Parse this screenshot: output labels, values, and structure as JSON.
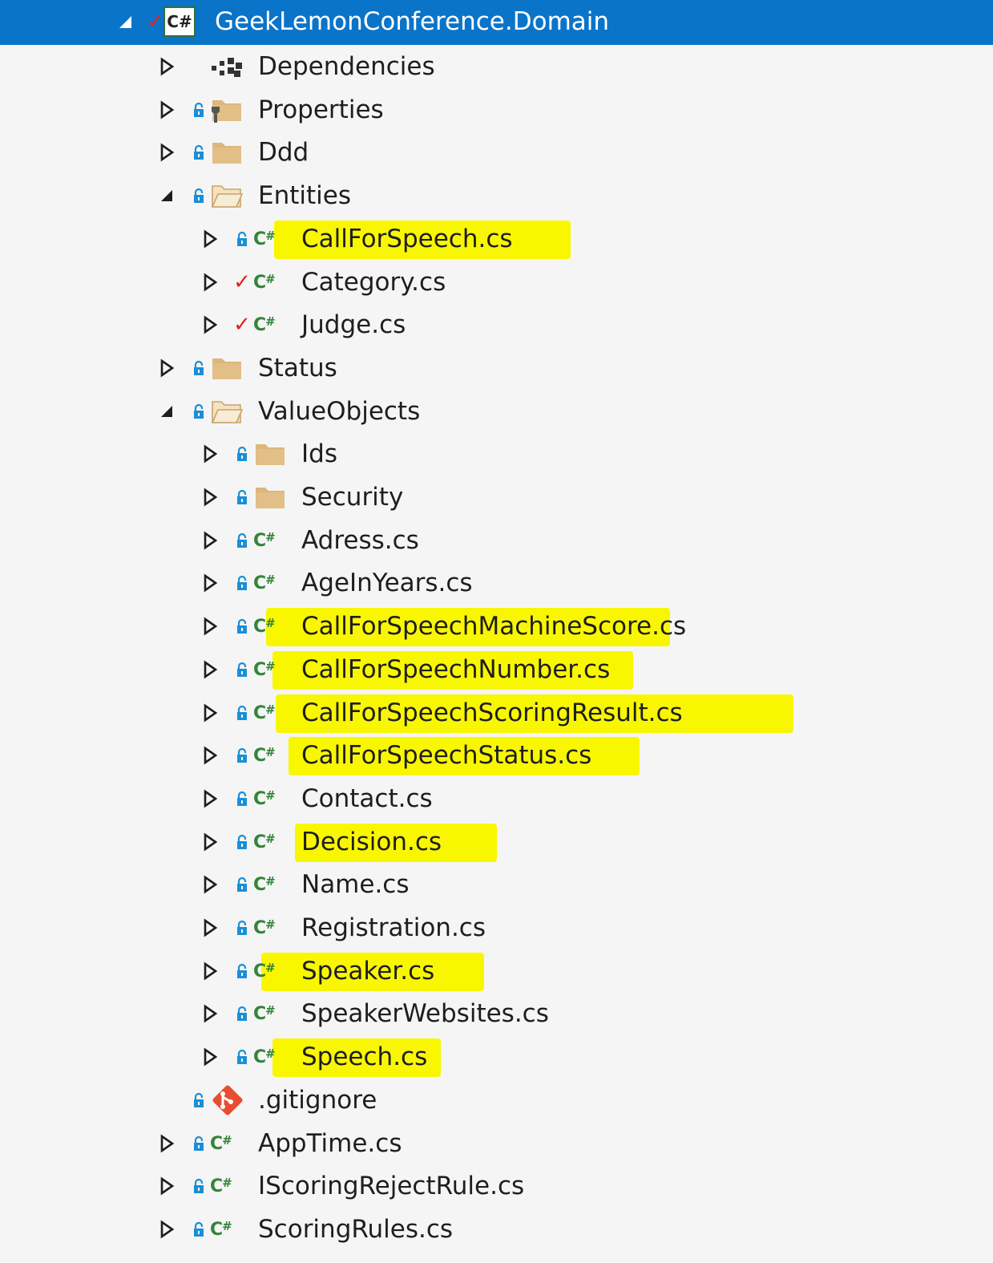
{
  "project": {
    "name": "GeekLemonConference.Domain",
    "icon": "csharp-project-icon"
  },
  "highlight_color": "#f9f700",
  "selection_color": "#0a74c9",
  "items": [
    {
      "key": "dependencies",
      "label": "Dependencies",
      "depth": 1,
      "expander": "collapsed",
      "status": "none",
      "icon": "dependencies-icon"
    },
    {
      "key": "properties",
      "label": "Properties",
      "depth": 1,
      "expander": "collapsed",
      "status": "lock",
      "icon": "properties-folder-icon"
    },
    {
      "key": "ddd",
      "label": "Ddd",
      "depth": 1,
      "expander": "collapsed",
      "status": "lock",
      "icon": "folder-icon"
    },
    {
      "key": "entities",
      "label": "Entities",
      "depth": 1,
      "expander": "expanded",
      "status": "lock",
      "icon": "folder-open-icon"
    },
    {
      "key": "callforspeech",
      "label": "CallForSpeech.cs",
      "depth": 2,
      "expander": "collapsed",
      "status": "lock",
      "icon": "csharp-file-icon",
      "highlighted": true
    },
    {
      "key": "category",
      "label": "Category.cs",
      "depth": 2,
      "expander": "collapsed",
      "status": "check",
      "icon": "csharp-file-icon"
    },
    {
      "key": "judge",
      "label": "Judge.cs",
      "depth": 2,
      "expander": "collapsed",
      "status": "check",
      "icon": "csharp-file-icon"
    },
    {
      "key": "status",
      "label": "Status",
      "depth": 1,
      "expander": "collapsed",
      "status": "lock",
      "icon": "folder-icon"
    },
    {
      "key": "valueobjects",
      "label": "ValueObjects",
      "depth": 1,
      "expander": "expanded",
      "status": "lock",
      "icon": "folder-open-icon"
    },
    {
      "key": "ids",
      "label": "Ids",
      "depth": 2,
      "expander": "collapsed",
      "status": "lock",
      "icon": "folder-icon"
    },
    {
      "key": "security",
      "label": "Security",
      "depth": 2,
      "expander": "collapsed",
      "status": "lock",
      "icon": "folder-icon"
    },
    {
      "key": "adress",
      "label": "Adress.cs",
      "depth": 2,
      "expander": "collapsed",
      "status": "lock",
      "icon": "csharp-file-icon"
    },
    {
      "key": "ageinyears",
      "label": "AgeInYears.cs",
      "depth": 2,
      "expander": "collapsed",
      "status": "lock",
      "icon": "csharp-file-icon"
    },
    {
      "key": "cfsmachinescore",
      "label": "CallForSpeechMachineScore.cs",
      "depth": 2,
      "expander": "collapsed",
      "status": "lock",
      "icon": "csharp-file-icon",
      "highlighted": true
    },
    {
      "key": "cfsnumber",
      "label": "CallForSpeechNumber.cs",
      "depth": 2,
      "expander": "collapsed",
      "status": "lock",
      "icon": "csharp-file-icon",
      "highlighted": true
    },
    {
      "key": "cfsscoringresult",
      "label": "CallForSpeechScoringResult.cs",
      "depth": 2,
      "expander": "collapsed",
      "status": "lock",
      "icon": "csharp-file-icon",
      "highlighted": true
    },
    {
      "key": "cfsstatus",
      "label": "CallForSpeechStatus.cs",
      "depth": 2,
      "expander": "collapsed",
      "status": "lock",
      "icon": "csharp-file-icon",
      "highlighted": true
    },
    {
      "key": "contact",
      "label": "Contact.cs",
      "depth": 2,
      "expander": "collapsed",
      "status": "lock",
      "icon": "csharp-file-icon"
    },
    {
      "key": "decision",
      "label": "Decision.cs",
      "depth": 2,
      "expander": "collapsed",
      "status": "lock",
      "icon": "csharp-file-icon",
      "highlighted": true
    },
    {
      "key": "name",
      "label": "Name.cs",
      "depth": 2,
      "expander": "collapsed",
      "status": "lock",
      "icon": "csharp-file-icon"
    },
    {
      "key": "registration",
      "label": "Registration.cs",
      "depth": 2,
      "expander": "collapsed",
      "status": "lock",
      "icon": "csharp-file-icon"
    },
    {
      "key": "speaker",
      "label": "Speaker.cs",
      "depth": 2,
      "expander": "collapsed",
      "status": "lock",
      "icon": "csharp-file-icon",
      "highlighted": true
    },
    {
      "key": "speakerwebsites",
      "label": "SpeakerWebsites.cs",
      "depth": 2,
      "expander": "collapsed",
      "status": "lock",
      "icon": "csharp-file-icon"
    },
    {
      "key": "speech",
      "label": "Speech.cs",
      "depth": 2,
      "expander": "collapsed",
      "status": "lock",
      "icon": "csharp-file-icon",
      "highlighted": true
    },
    {
      "key": "gitignore",
      "label": ".gitignore",
      "depth": 1,
      "expander": "none",
      "status": "lock",
      "icon": "git-icon"
    },
    {
      "key": "apptime",
      "label": "AppTime.cs",
      "depth": 1,
      "expander": "collapsed",
      "status": "lock",
      "icon": "csharp-file-icon"
    },
    {
      "key": "iscoringrejectrule",
      "label": "IScoringRejectRule.cs",
      "depth": 1,
      "expander": "collapsed",
      "status": "lock",
      "icon": "csharp-file-icon"
    },
    {
      "key": "scoringrules",
      "label": "ScoringRules.cs",
      "depth": 1,
      "expander": "collapsed",
      "status": "lock",
      "icon": "csharp-file-icon"
    }
  ]
}
